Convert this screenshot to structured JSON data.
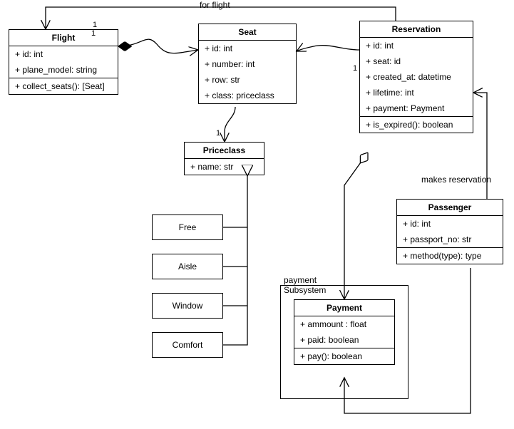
{
  "labels": {
    "for_flight": "for flight",
    "makes_res": "makes reservation",
    "subsystem_l1": "payment",
    "subsystem_l2": "Subsystem",
    "one_a": "1",
    "one_b": "1",
    "one_c": "1",
    "one_d": "1",
    "one_e": "1"
  },
  "flight": {
    "title": "Flight",
    "attrs": [
      "+ id: int",
      "+ plane_model: string"
    ],
    "ops": [
      "+ collect_seats(): [Seat]"
    ]
  },
  "seat": {
    "title": "Seat",
    "attrs": [
      "+ id: int",
      "+ number: int",
      "+ row: str",
      "+ class: priceclass"
    ]
  },
  "reservation": {
    "title": "Reservation",
    "attrs": [
      "+ id: int",
      "+ seat: id",
      "+ created_at: datetime",
      "+ lifetime: int",
      "+ payment: Payment"
    ],
    "ops": [
      "+ is_expired(): boolean"
    ]
  },
  "priceclass": {
    "title": "Priceclass",
    "attrs": [
      "+ name: str"
    ]
  },
  "passenger": {
    "title": "Passenger",
    "attrs": [
      "+ id: int",
      "+ passport_no: str"
    ],
    "ops": [
      "+ method(type): type"
    ]
  },
  "payment": {
    "title": "Payment",
    "attrs": [
      "+ ammount : float",
      "+ paid: boolean"
    ],
    "ops": [
      "+ pay(): boolean"
    ]
  },
  "subs": {
    "free": "Free",
    "aisle": "Aisle",
    "window": "Window",
    "comfort": "Comfort"
  },
  "chart_data": {
    "type": "table",
    "description": "UML class diagram for a flight reservation domain",
    "classes": [
      {
        "name": "Flight",
        "attributes": [
          "id: int",
          "plane_model: string"
        ],
        "operations": [
          "collect_seats(): [Seat]"
        ]
      },
      {
        "name": "Seat",
        "attributes": [
          "id: int",
          "number: int",
          "row: str",
          "class: priceclass"
        ],
        "operations": []
      },
      {
        "name": "Reservation",
        "attributes": [
          "id: int",
          "seat: id",
          "created_at: datetime",
          "lifetime: int",
          "payment: Payment"
        ],
        "operations": [
          "is_expired(): boolean"
        ]
      },
      {
        "name": "Priceclass",
        "attributes": [
          "name: str"
        ],
        "operations": []
      },
      {
        "name": "Passenger",
        "attributes": [
          "id: int",
          "passport_no: str"
        ],
        "operations": [
          "method(type): type"
        ]
      },
      {
        "name": "Payment",
        "attributes": [
          "ammount: float",
          "paid: boolean"
        ],
        "operations": [
          "pay(): boolean"
        ]
      }
    ],
    "subclasses_of_priceclass": [
      "Free",
      "Aisle",
      "Window",
      "Comfort"
    ],
    "relationships": [
      {
        "from": "Flight",
        "to": "Seat",
        "type": "composition",
        "multiplicity_from": "1"
      },
      {
        "from": "Reservation",
        "to": "Seat",
        "type": "association",
        "multiplicity_to": "1"
      },
      {
        "from": "Reservation",
        "to": "Flight",
        "type": "association",
        "label": "for flight",
        "multiplicity_to": "1"
      },
      {
        "from": "Seat",
        "to": "Priceclass",
        "type": "association",
        "multiplicity_to": "1"
      },
      {
        "from": "Passenger",
        "to": "Reservation",
        "type": "association",
        "label": "makes reservation"
      },
      {
        "from": "Reservation",
        "to": "Payment",
        "type": "aggregation",
        "multiplicity_from": "1"
      },
      {
        "from": "Passenger",
        "to": "Payment",
        "type": "association"
      },
      {
        "from": "Free",
        "to": "Priceclass",
        "type": "generalization"
      },
      {
        "from": "Aisle",
        "to": "Priceclass",
        "type": "generalization"
      },
      {
        "from": "Window",
        "to": "Priceclass",
        "type": "generalization"
      },
      {
        "from": "Comfort",
        "to": "Priceclass",
        "type": "generalization"
      }
    ]
  }
}
